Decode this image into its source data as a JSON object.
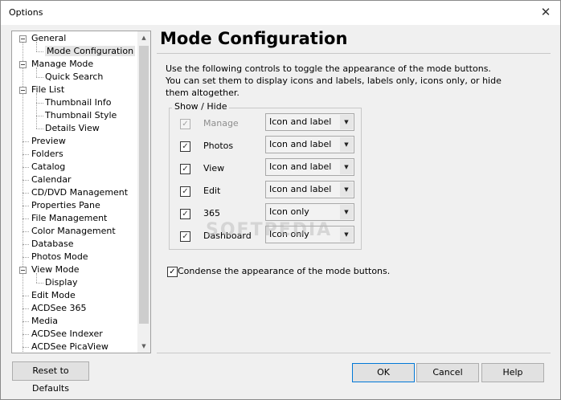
{
  "window": {
    "title": "Options",
    "close_glyph": "✕"
  },
  "tree": {
    "items": [
      {
        "label": "General",
        "level": 0,
        "expander": true
      },
      {
        "label": "Mode Configuration",
        "level": 1,
        "selected": true
      },
      {
        "label": "Manage Mode",
        "level": 0,
        "expander": true
      },
      {
        "label": "Quick Search",
        "level": 1
      },
      {
        "label": "File List",
        "level": 0,
        "expander": true
      },
      {
        "label": "Thumbnail Info",
        "level": 1
      },
      {
        "label": "Thumbnail Style",
        "level": 1
      },
      {
        "label": "Details View",
        "level": 1
      },
      {
        "label": "Preview",
        "level": 0
      },
      {
        "label": "Folders",
        "level": 0
      },
      {
        "label": "Catalog",
        "level": 0
      },
      {
        "label": "Calendar",
        "level": 0
      },
      {
        "label": "CD/DVD Management",
        "level": 0
      },
      {
        "label": "Properties Pane",
        "level": 0
      },
      {
        "label": "File Management",
        "level": 0
      },
      {
        "label": "Color Management",
        "level": 0
      },
      {
        "label": "Database",
        "level": 0
      },
      {
        "label": "Photos Mode",
        "level": 0
      },
      {
        "label": "View Mode",
        "level": 0,
        "expander": true
      },
      {
        "label": "Display",
        "level": 1
      },
      {
        "label": "Edit Mode",
        "level": 0
      },
      {
        "label": "ACDSee 365",
        "level": 0
      },
      {
        "label": "Media",
        "level": 0
      },
      {
        "label": "ACDSee Indexer",
        "level": 0
      },
      {
        "label": "ACDSee PicaView",
        "level": 0
      }
    ]
  },
  "main": {
    "heading": "Mode Configuration",
    "description": "Use the following controls to toggle the appearance of the mode buttons. You can set them to display icons and labels, labels only, icons only, or hide them altogether.",
    "group_title": "Show / Hide",
    "check_glyph": "✓",
    "dropdown_glyph": "▼",
    "rows": [
      {
        "label": "Manage",
        "checked": true,
        "disabled": true,
        "option": "Icon and label"
      },
      {
        "label": "Photos",
        "checked": true,
        "disabled": false,
        "option": "Icon and label"
      },
      {
        "label": "View",
        "checked": true,
        "disabled": false,
        "option": "Icon and label"
      },
      {
        "label": "Edit",
        "checked": true,
        "disabled": false,
        "option": "Icon and label"
      },
      {
        "label": "365",
        "checked": true,
        "disabled": false,
        "option": "Icon only"
      },
      {
        "label": "Dashboard",
        "checked": true,
        "disabled": false,
        "option": "Icon only"
      }
    ],
    "condense_label": "Condense the appearance of the mode buttons.",
    "condense_checked": true
  },
  "footer": {
    "reset_label": "Reset to Defaults",
    "ok_label": "OK",
    "cancel_label": "Cancel",
    "help_label": "Help"
  },
  "watermark": "SOFTPEDIA",
  "scroll_glyphs": {
    "up": "▲",
    "down": "▼"
  }
}
